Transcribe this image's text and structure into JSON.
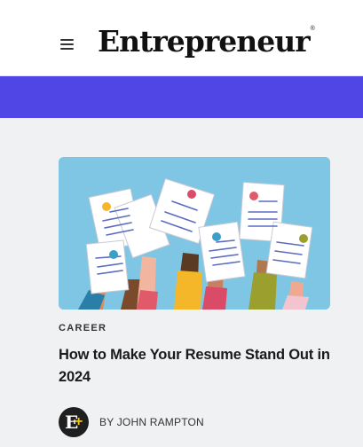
{
  "header": {
    "menu_icon": "hamburger-menu-icon",
    "logo_text": "Entrepreneur",
    "logo_mark": "®"
  },
  "banner": {
    "color": "#5045e5"
  },
  "article": {
    "image_alt": "Hands holding up resumes",
    "category": "CAREER",
    "title": "How to Make Your Resume Stand Out in 2024",
    "author_avatar": "entrepreneur-plus-avatar",
    "author_avatar_letter": "E",
    "author_avatar_plus": "+",
    "byline": "BY JOHN RAMPTON"
  },
  "colors": {
    "background": "#f0f1f3",
    "header": "#ffffff",
    "accent": "#5045e5",
    "image_background": "#7ec6e3",
    "plus_yellow": "#f5c518"
  }
}
